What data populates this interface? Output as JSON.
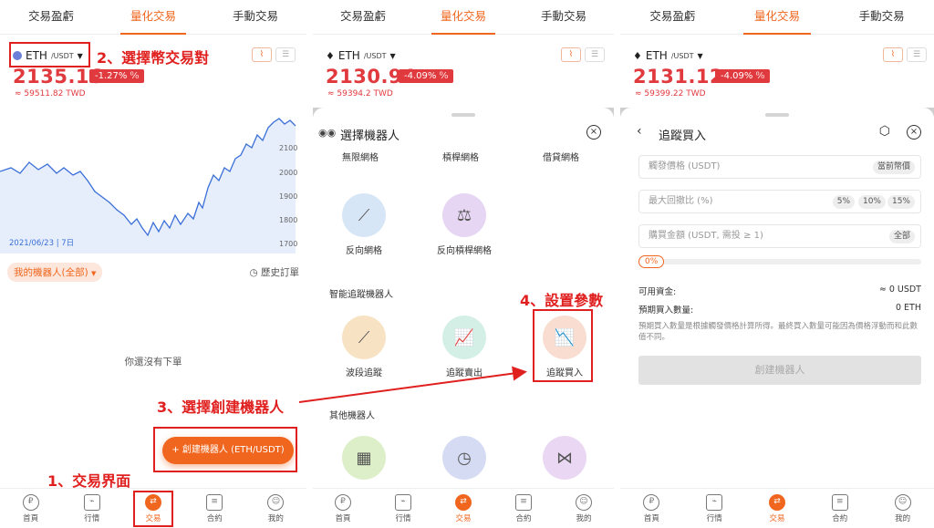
{
  "tabs": [
    "交易盈虧",
    "量化交易",
    "手動交易"
  ],
  "nav": [
    "首頁",
    "行情",
    "交易",
    "合約",
    "我的"
  ],
  "panel1": {
    "pair": "ETH",
    "pair_quote": "/USDT",
    "price": "2135.16",
    "change": "-1.27%",
    "twd": "≈ 59511.82 TWD",
    "chart_y_ticks": [
      "2100",
      "2000",
      "1900",
      "1800",
      "1700"
    ],
    "date_label": "2021/06/23 | 7日",
    "my_bots": "我的機器人(全部)",
    "history": "歷史訂單",
    "empty": "你還沒有下單",
    "create_btn": "+ 創建機器人 (ETH/USDT)"
  },
  "panel2": {
    "pair": "ETH",
    "pair_quote": "/USDT",
    "price": "2130.94",
    "change": "-4.09%",
    "twd": "≈ 59394.2 TWD",
    "sheet_title": "選擇機器人",
    "top_row": [
      "無限網格",
      "槓桿網格",
      "借貸網格"
    ],
    "row2": [
      "反向網格",
      "反向槓桿網格"
    ],
    "section_smart": "智能追蹤機器人",
    "smart": [
      "波段追蹤",
      "追蹤賣出",
      "追蹤買入"
    ],
    "section_other": "其他機器人"
  },
  "panel3": {
    "pair": "ETH",
    "pair_quote": "/USDT",
    "price": "2131.12",
    "change": "-4.09%",
    "twd": "≈ 59399.22 TWD",
    "title": "追蹤買入",
    "trigger_placeholder": "觸發價格 (USDT)",
    "trigger_chip": "當前幣價",
    "pullback_placeholder": "最大回撤比 (%)",
    "pullback_chips": [
      "5%",
      "10%",
      "15%"
    ],
    "amount_placeholder": "購買金額 (USDT, 需投 ≥ 1)",
    "amount_chip": "全部",
    "progress": "0%",
    "available_label": "可用資金:",
    "available_value": "≈ 0 USDT",
    "expected_label": "預期買入數量:",
    "expected_value": "0 ETH",
    "note": "預期買入數量是根據觸發價格計算所得。最終買入數量可能因為價格浮動而和此數值不同。",
    "create_btn": "創建機器人"
  },
  "annotations": {
    "step1": "1、交易界面",
    "step2": "2、選擇幣交易對",
    "step3": "3、選擇創建機器人",
    "step4": "4、設置參數"
  },
  "colors": {
    "accent": "#f0661e",
    "down": "#e0393e",
    "annotation": "#e01f1f",
    "chart_line": "#3a6fd8"
  }
}
